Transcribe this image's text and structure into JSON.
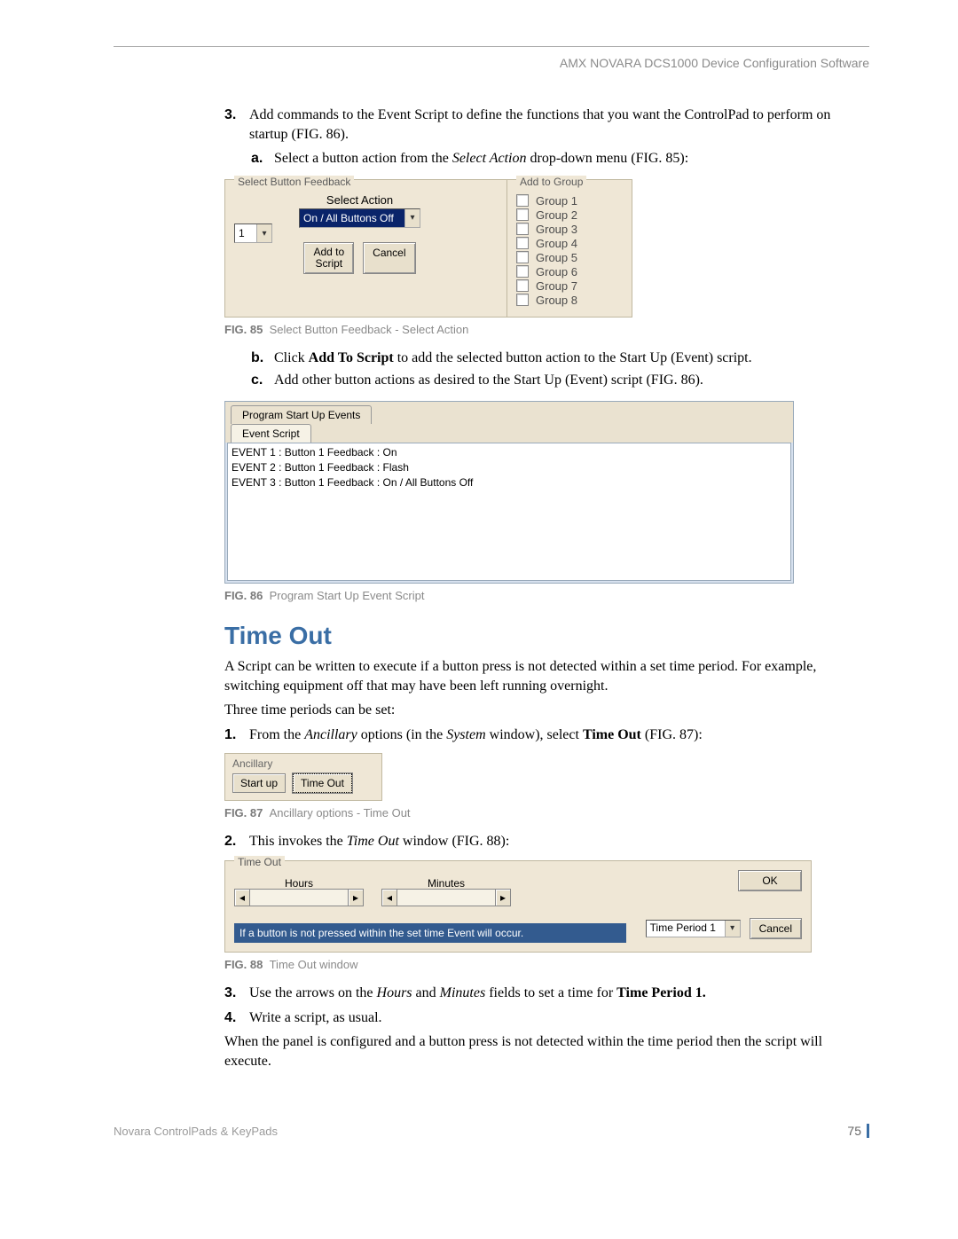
{
  "header": "AMX NOVARA DCS1000 Device Configuration Software",
  "step3": {
    "num": "3.",
    "text": "Add commands to the Event Script to define the functions that you want the ControlPad to perform on startup (FIG. 86)."
  },
  "step3a": {
    "let": "a.",
    "pre": "Select a button action from the ",
    "em": "Select Action",
    "post": " drop-down menu (FIG. 85):"
  },
  "fig85": {
    "left_legend": "Select Button Feedback",
    "select_action_label": "Select Action",
    "dd_value": "On / All Buttons Off",
    "num_value": "1",
    "btn_add": "Add to\nScript",
    "btn_cancel": "Cancel",
    "right_legend": "Add to Group",
    "groups": [
      "Group 1",
      "Group 2",
      "Group 3",
      "Group 4",
      "Group 5",
      "Group 6",
      "Group 7",
      "Group 8"
    ],
    "caption_label": "FIG. 85",
    "caption_text": "Select Button Feedback - Select Action"
  },
  "step3b": {
    "let": "b.",
    "pre": "Click ",
    "bold": "Add To Script",
    "post": " to add the selected button action to the Start Up (Event) script."
  },
  "step3c": {
    "let": "c.",
    "text": "Add other button actions as desired to the Start Up (Event) script (FIG. 86)."
  },
  "fig86": {
    "tab1": "Program Start Up Events",
    "tab2": "Event Script",
    "events": [
      "EVENT 1  : Button 1 Feedback : On",
      "EVENT 2  : Button 1 Feedback : Flash",
      "EVENT 3  : Button 1 Feedback : On / All Buttons Off"
    ],
    "caption_label": "FIG. 86",
    "caption_text": "Program Start Up Event Script"
  },
  "section_title": "Time Out",
  "para1": "A Script can be written to execute if a button press is not detected within a set time period. For example, switching equipment off that may have been left running overnight.",
  "para2": "Three time periods can be set:",
  "step1": {
    "num": "1.",
    "pre": "From the ",
    "em1": "Ancillary",
    "mid": " options (in the ",
    "em2": "System",
    "mid2": " window), select ",
    "bold": "Time Out",
    "post": " (FIG. 87):"
  },
  "fig87": {
    "legend": "Ancillary",
    "btn1": "Start up",
    "btn2": "Time Out",
    "caption_label": "FIG. 87",
    "caption_text": "Ancillary options - Time Out"
  },
  "step2": {
    "num": "2.",
    "pre": "This invokes the ",
    "em": "Time Out",
    "post": " window (FIG. 88):"
  },
  "fig88": {
    "legend": "Time Out",
    "hours": "Hours",
    "minutes": "Minutes",
    "ok": "OK",
    "msg": "If a button is not pressed within the set time Event will occur.",
    "tp": "Time Period 1",
    "cancel": "Cancel",
    "caption_label": "FIG. 88",
    "caption_text": "Time Out window"
  },
  "step3b2": {
    "num": "3.",
    "pre": "Use the arrows on the ",
    "em1": "Hours",
    "mid": " and ",
    "em2": "Minutes",
    "mid2": " fields to set a time for ",
    "bold": "Time Period 1."
  },
  "step4": {
    "num": "4.",
    "text": "Write a script, as usual."
  },
  "para3": "When the panel is configured and a button press is not detected within the time period then the script will execute.",
  "footer_left": "Novara ControlPads   & KeyPads",
  "footer_page": "75"
}
